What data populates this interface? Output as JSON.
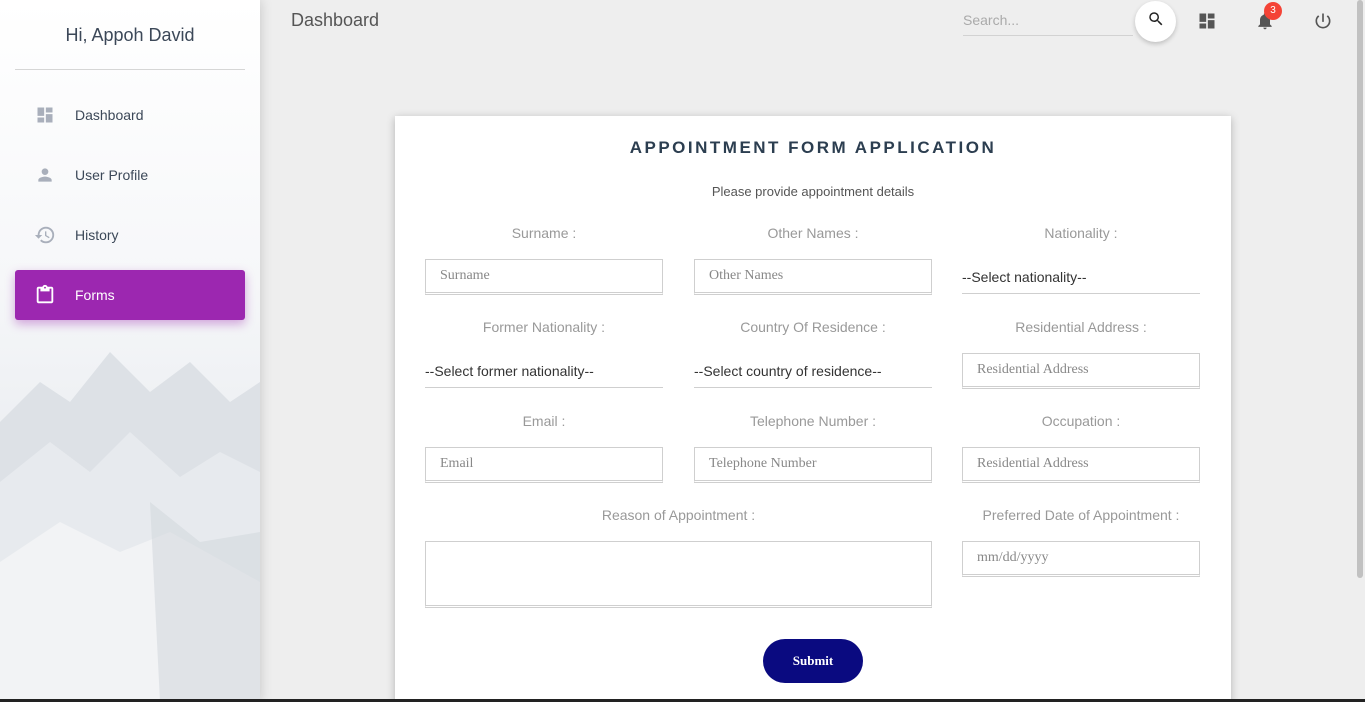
{
  "sidebar": {
    "greeting": "Hi, Appoh David",
    "items": [
      {
        "label": "Dashboard",
        "icon": "dashboard-icon"
      },
      {
        "label": "User Profile",
        "icon": "person-icon"
      },
      {
        "label": "History",
        "icon": "history-icon"
      },
      {
        "label": "Forms",
        "icon": "clipboard-icon",
        "active": true
      }
    ]
  },
  "topbar": {
    "title": "Dashboard",
    "search_placeholder": "Search...",
    "notification_count": "3"
  },
  "form": {
    "title": "APPOINTMENT FORM APPLICATION",
    "subtitle": "Please provide appointment details",
    "surname": {
      "label": "Surname :",
      "placeholder": "Surname"
    },
    "other_names": {
      "label": "Other Names :",
      "placeholder": "Other Names"
    },
    "nationality": {
      "label": "Nationality :",
      "value": "--Select nationality--"
    },
    "former_nationality": {
      "label": "Former Nationality :",
      "value": "--Select former nationality--"
    },
    "country_of_residence": {
      "label": "Country Of Residence :",
      "value": "--Select country of residence--"
    },
    "residential_address": {
      "label": "Residential Address :",
      "placeholder": "Residential Address"
    },
    "email": {
      "label": "Email :",
      "placeholder": "Email"
    },
    "telephone": {
      "label": "Telephone Number :",
      "placeholder": "Telephone Number"
    },
    "occupation": {
      "label": "Occupation :",
      "placeholder": "Residential Address"
    },
    "reason": {
      "label": "Reason of Appointment :"
    },
    "preferred_date": {
      "label": "Preferred Date of Appointment :",
      "placeholder": "mm/dd/yyyy"
    },
    "submit_label": "Submit"
  },
  "colors": {
    "accent": "#9c27b0",
    "submit": "#0a0a80",
    "badge": "#f44336"
  }
}
